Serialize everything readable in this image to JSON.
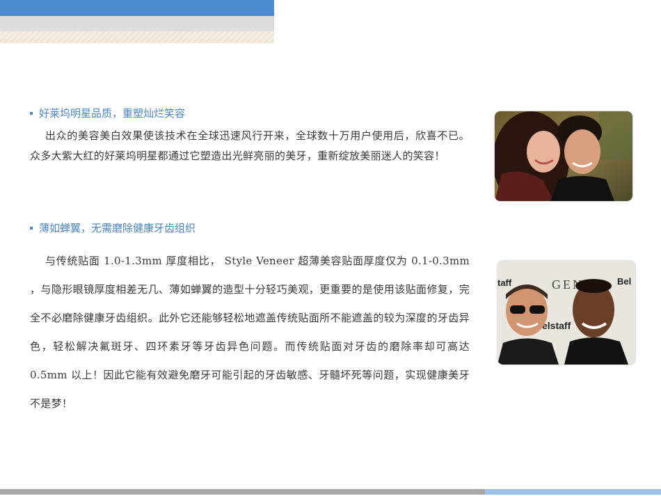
{
  "section1": {
    "heading": "好莱坞明星品质，重塑灿烂笑容",
    "body": "出众的美容美白效果使该技术在全球迅速风行开来，全球数十万用户使用后，欣喜不已。众多大紫大红的好莱坞明星都通过它塑造出光鲜亮丽的美牙，重新绽放美丽迷人的笑容！"
  },
  "section2": {
    "heading": "薄如蝉翼，无需磨除健康牙齿组织",
    "body": "与传统贴面 1.0-1.3mm 厚度相比， Style Veneer 超薄美容贴面厚度仅为 0.1-0.3mm ，与隐形眼镜厚度相差无几、薄如蝉翼的造型十分轻巧美观，更重要的是使用该贴面修复，完全不必磨除健康牙齿组织。此外它还能够轻松地遮盖传统贴面所不能遮盖的较为深度的牙齿异色，轻松解决氟斑牙、四环素牙等牙齿异色问题。而传统贴面对牙齿的磨除率却可高达 0.5mm 以上！因此它能有效避免磨牙可能引起的牙齿敏感、牙髓坏死等问题，实现健康美牙不是梦！"
  },
  "photo2": {
    "backdrop_text_left": "taff",
    "backdrop_text_center": "GEN",
    "backdrop_text_right": "Bel",
    "backdrop_text_lower": "elstaff"
  },
  "colors": {
    "accent_blue": "#4a86c8",
    "body_text": "#3a3a3a"
  }
}
